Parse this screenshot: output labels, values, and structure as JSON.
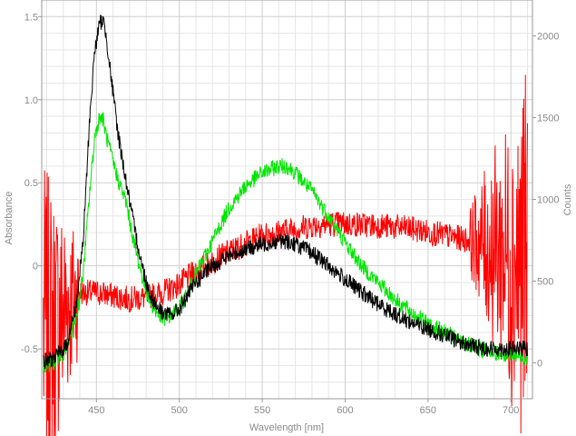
{
  "chart_data": {
    "type": "line",
    "xlabel": "Wavelength [nm]",
    "ylabel_left": "Absorbance",
    "ylabel_right": "Counts",
    "xlim": [
      417,
      713
    ],
    "ylim_left": [
      -0.8,
      1.6
    ],
    "ylim_right": [
      -220,
      2220
    ],
    "x_ticks": [
      450,
      500,
      550,
      600,
      650,
      700
    ],
    "y_left_ticks": [
      -0.5,
      0,
      0.5,
      1.0,
      1.5
    ],
    "y_left_tick_labels": [
      "-0.5",
      "0",
      "0.5",
      "1.0",
      "1.5"
    ],
    "y_right_ticks": [
      0,
      500,
      1000,
      1500,
      2000
    ],
    "grid": true,
    "legend": "none",
    "series": [
      {
        "axis": "left",
        "color": "#000000",
        "x": [
          418,
          425,
          432,
          438,
          442,
          446,
          449,
          452,
          454,
          456,
          459,
          463,
          468,
          473,
          478,
          482,
          486,
          490,
          495,
          500,
          505,
          510,
          520,
          530,
          540,
          550,
          560,
          565,
          570,
          580,
          590,
          600,
          610,
          620,
          630,
          640,
          650,
          660,
          670,
          680,
          690,
          700,
          710
        ],
        "y": [
          -0.58,
          -0.55,
          -0.48,
          -0.22,
          0.15,
          0.9,
          1.3,
          1.46,
          1.48,
          1.38,
          1.12,
          0.8,
          0.5,
          0.22,
          -0.02,
          -0.16,
          -0.24,
          -0.28,
          -0.3,
          -0.26,
          -0.18,
          -0.1,
          0.0,
          0.06,
          0.1,
          0.13,
          0.15,
          0.15,
          0.13,
          0.08,
          0.0,
          -0.08,
          -0.16,
          -0.23,
          -0.29,
          -0.34,
          -0.38,
          -0.42,
          -0.46,
          -0.49,
          -0.5,
          -0.5,
          -0.5
        ]
      },
      {
        "axis": "left",
        "color": "#00e600",
        "x": [
          418,
          425,
          432,
          438,
          442,
          446,
          449,
          452,
          454,
          456,
          459,
          463,
          468,
          473,
          478,
          482,
          486,
          490,
          495,
          500,
          505,
          510,
          520,
          530,
          540,
          550,
          560,
          565,
          570,
          580,
          590,
          600,
          610,
          620,
          630,
          640,
          650,
          660,
          670,
          680,
          690,
          700,
          710
        ],
        "y": [
          -0.6,
          -0.58,
          -0.5,
          -0.3,
          -0.05,
          0.45,
          0.78,
          0.9,
          0.88,
          0.78,
          0.66,
          0.52,
          0.38,
          0.12,
          -0.08,
          -0.2,
          -0.28,
          -0.32,
          -0.3,
          -0.25,
          -0.16,
          -0.05,
          0.15,
          0.35,
          0.48,
          0.56,
          0.6,
          0.6,
          0.56,
          0.45,
          0.3,
          0.14,
          0.0,
          -0.1,
          -0.2,
          -0.28,
          -0.35,
          -0.4,
          -0.46,
          -0.5,
          -0.52,
          -0.54,
          -0.55
        ]
      },
      {
        "axis": "right",
        "color": "#ff0000",
        "x": [
          418,
          425,
          432,
          440,
          450,
          460,
          470,
          480,
          490,
          500,
          510,
          520,
          530,
          540,
          550,
          560,
          570,
          580,
          590,
          600,
          610,
          620,
          630,
          640,
          650,
          660,
          670,
          680,
          690,
          700,
          710
        ],
        "y": [
          200,
          250,
          350,
          430,
          430,
          410,
          390,
          400,
          430,
          480,
          560,
          620,
          680,
          730,
          780,
          800,
          820,
          840,
          850,
          850,
          845,
          840,
          830,
          820,
          800,
          780,
          760,
          740,
          700,
          650,
          620
        ]
      }
    ]
  }
}
